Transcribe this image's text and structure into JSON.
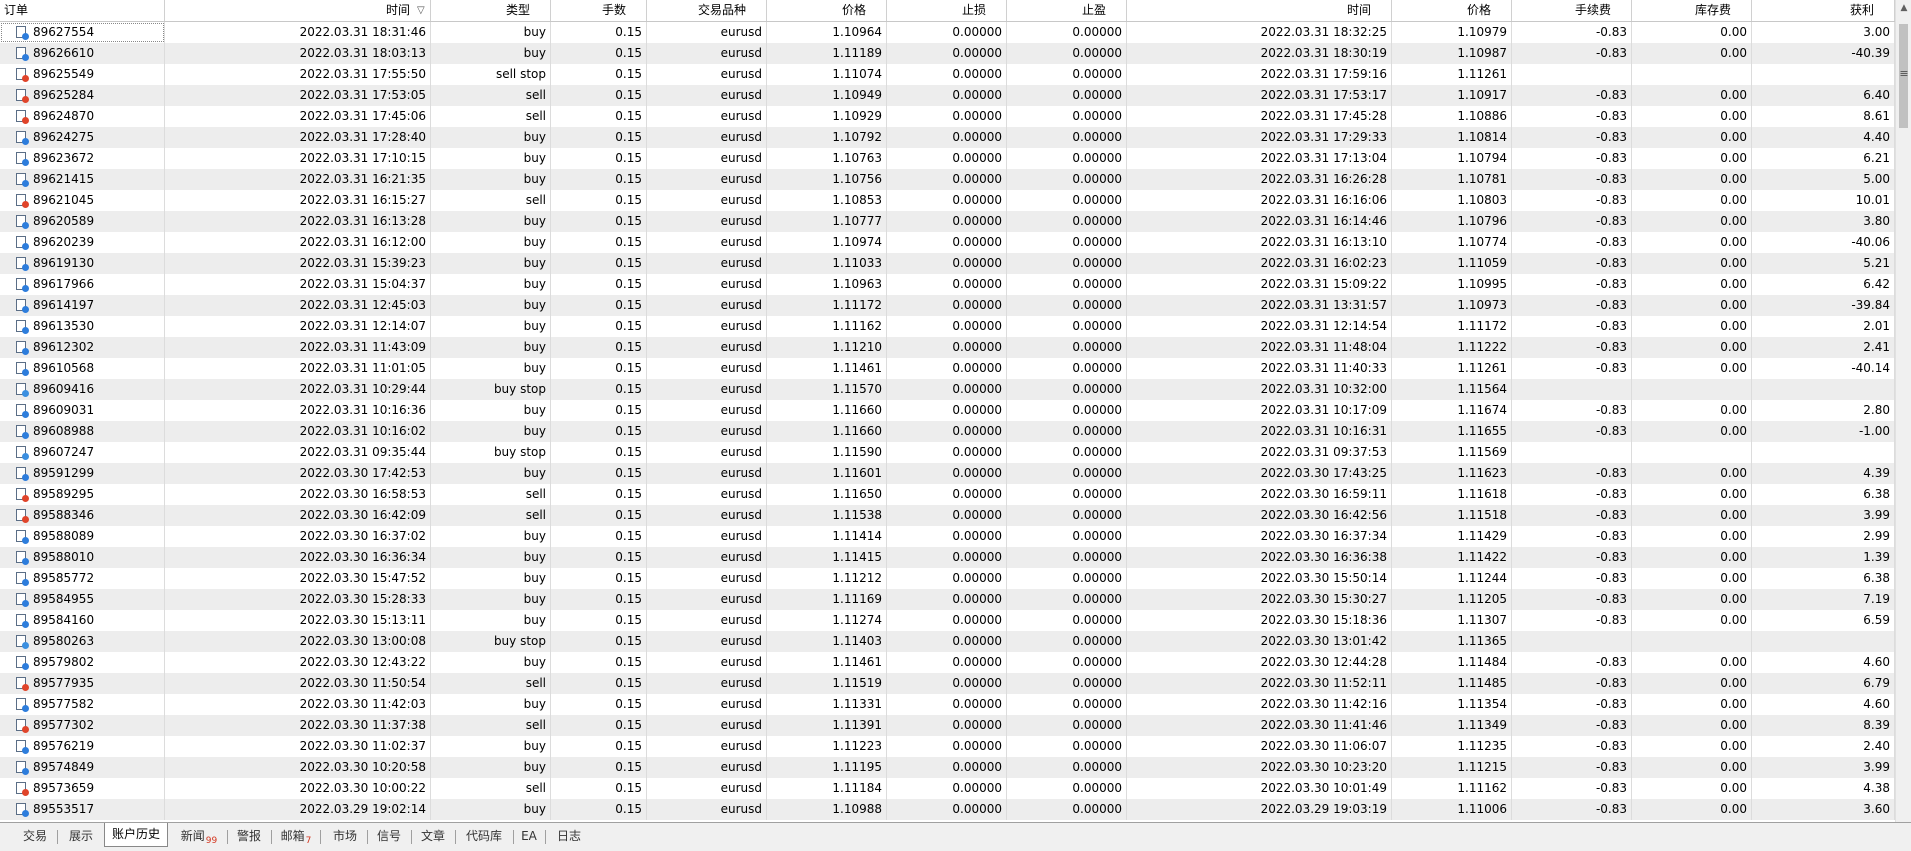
{
  "columns": [
    "订单",
    "时间",
    "类型",
    "手数",
    "交易品种",
    "价格",
    "止损",
    "止盈",
    "时间",
    "价格",
    "手续费",
    "库存费",
    "获利"
  ],
  "sort_indicator": "▽",
  "rows": [
    {
      "order": "89627554",
      "open_time": "2022.03.31 18:31:46",
      "type": "buy",
      "lots": "0.15",
      "symbol": "eurusd",
      "open_price": "1.10964",
      "sl": "0.00000",
      "tp": "0.00000",
      "close_time": "2022.03.31 18:32:25",
      "close_price": "1.10979",
      "commission": "-0.83",
      "swap": "0.00",
      "profit": "3.00",
      "icon": "buy"
    },
    {
      "order": "89626610",
      "open_time": "2022.03.31 18:03:13",
      "type": "buy",
      "lots": "0.15",
      "symbol": "eurusd",
      "open_price": "1.11189",
      "sl": "0.00000",
      "tp": "0.00000",
      "close_time": "2022.03.31 18:30:19",
      "close_price": "1.10987",
      "commission": "-0.83",
      "swap": "0.00",
      "profit": "-40.39",
      "icon": "buy"
    },
    {
      "order": "89625549",
      "open_time": "2022.03.31 17:55:50",
      "type": "sell stop",
      "lots": "0.15",
      "symbol": "eurusd",
      "open_price": "1.11074",
      "sl": "0.00000",
      "tp": "0.00000",
      "close_time": "2022.03.31 17:59:16",
      "close_price": "1.11261",
      "commission": "",
      "swap": "",
      "profit": "",
      "icon": "sell"
    },
    {
      "order": "89625284",
      "open_time": "2022.03.31 17:53:05",
      "type": "sell",
      "lots": "0.15",
      "symbol": "eurusd",
      "open_price": "1.10949",
      "sl": "0.00000",
      "tp": "0.00000",
      "close_time": "2022.03.31 17:53:17",
      "close_price": "1.10917",
      "commission": "-0.83",
      "swap": "0.00",
      "profit": "6.40",
      "icon": "sell"
    },
    {
      "order": "89624870",
      "open_time": "2022.03.31 17:45:06",
      "type": "sell",
      "lots": "0.15",
      "symbol": "eurusd",
      "open_price": "1.10929",
      "sl": "0.00000",
      "tp": "0.00000",
      "close_time": "2022.03.31 17:45:28",
      "close_price": "1.10886",
      "commission": "-0.83",
      "swap": "0.00",
      "profit": "8.61",
      "icon": "sell"
    },
    {
      "order": "89624275",
      "open_time": "2022.03.31 17:28:40",
      "type": "buy",
      "lots": "0.15",
      "symbol": "eurusd",
      "open_price": "1.10792",
      "sl": "0.00000",
      "tp": "0.00000",
      "close_time": "2022.03.31 17:29:33",
      "close_price": "1.10814",
      "commission": "-0.83",
      "swap": "0.00",
      "profit": "4.40",
      "icon": "buy"
    },
    {
      "order": "89623672",
      "open_time": "2022.03.31 17:10:15",
      "type": "buy",
      "lots": "0.15",
      "symbol": "eurusd",
      "open_price": "1.10763",
      "sl": "0.00000",
      "tp": "0.00000",
      "close_time": "2022.03.31 17:13:04",
      "close_price": "1.10794",
      "commission": "-0.83",
      "swap": "0.00",
      "profit": "6.21",
      "icon": "buy"
    },
    {
      "order": "89621415",
      "open_time": "2022.03.31 16:21:35",
      "type": "buy",
      "lots": "0.15",
      "symbol": "eurusd",
      "open_price": "1.10756",
      "sl": "0.00000",
      "tp": "0.00000",
      "close_time": "2022.03.31 16:26:28",
      "close_price": "1.10781",
      "commission": "-0.83",
      "swap": "0.00",
      "profit": "5.00",
      "icon": "buy"
    },
    {
      "order": "89621045",
      "open_time": "2022.03.31 16:15:27",
      "type": "sell",
      "lots": "0.15",
      "symbol": "eurusd",
      "open_price": "1.10853",
      "sl": "0.00000",
      "tp": "0.00000",
      "close_time": "2022.03.31 16:16:06",
      "close_price": "1.10803",
      "commission": "-0.83",
      "swap": "0.00",
      "profit": "10.01",
      "icon": "sell"
    },
    {
      "order": "89620589",
      "open_time": "2022.03.31 16:13:28",
      "type": "buy",
      "lots": "0.15",
      "symbol": "eurusd",
      "open_price": "1.10777",
      "sl": "0.00000",
      "tp": "0.00000",
      "close_time": "2022.03.31 16:14:46",
      "close_price": "1.10796",
      "commission": "-0.83",
      "swap": "0.00",
      "profit": "3.80",
      "icon": "buy"
    },
    {
      "order": "89620239",
      "open_time": "2022.03.31 16:12:00",
      "type": "buy",
      "lots": "0.15",
      "symbol": "eurusd",
      "open_price": "1.10974",
      "sl": "0.00000",
      "tp": "0.00000",
      "close_time": "2022.03.31 16:13:10",
      "close_price": "1.10774",
      "commission": "-0.83",
      "swap": "0.00",
      "profit": "-40.06",
      "icon": "buy"
    },
    {
      "order": "89619130",
      "open_time": "2022.03.31 15:39:23",
      "type": "buy",
      "lots": "0.15",
      "symbol": "eurusd",
      "open_price": "1.11033",
      "sl": "0.00000",
      "tp": "0.00000",
      "close_time": "2022.03.31 16:02:23",
      "close_price": "1.11059",
      "commission": "-0.83",
      "swap": "0.00",
      "profit": "5.21",
      "icon": "buy"
    },
    {
      "order": "89617966",
      "open_time": "2022.03.31 15:04:37",
      "type": "buy",
      "lots": "0.15",
      "symbol": "eurusd",
      "open_price": "1.10963",
      "sl": "0.00000",
      "tp": "0.00000",
      "close_time": "2022.03.31 15:09:22",
      "close_price": "1.10995",
      "commission": "-0.83",
      "swap": "0.00",
      "profit": "6.42",
      "icon": "buy"
    },
    {
      "order": "89614197",
      "open_time": "2022.03.31 12:45:03",
      "type": "buy",
      "lots": "0.15",
      "symbol": "eurusd",
      "open_price": "1.11172",
      "sl": "0.00000",
      "tp": "0.00000",
      "close_time": "2022.03.31 13:31:57",
      "close_price": "1.10973",
      "commission": "-0.83",
      "swap": "0.00",
      "profit": "-39.84",
      "icon": "buy"
    },
    {
      "order": "89613530",
      "open_time": "2022.03.31 12:14:07",
      "type": "buy",
      "lots": "0.15",
      "symbol": "eurusd",
      "open_price": "1.11162",
      "sl": "0.00000",
      "tp": "0.00000",
      "close_time": "2022.03.31 12:14:54",
      "close_price": "1.11172",
      "commission": "-0.83",
      "swap": "0.00",
      "profit": "2.01",
      "icon": "buy"
    },
    {
      "order": "89612302",
      "open_time": "2022.03.31 11:43:09",
      "type": "buy",
      "lots": "0.15",
      "symbol": "eurusd",
      "open_price": "1.11210",
      "sl": "0.00000",
      "tp": "0.00000",
      "close_time": "2022.03.31 11:48:04",
      "close_price": "1.11222",
      "commission": "-0.83",
      "swap": "0.00",
      "profit": "2.41",
      "icon": "buy"
    },
    {
      "order": "89610568",
      "open_time": "2022.03.31 11:01:05",
      "type": "buy",
      "lots": "0.15",
      "symbol": "eurusd",
      "open_price": "1.11461",
      "sl": "0.00000",
      "tp": "0.00000",
      "close_time": "2022.03.31 11:40:33",
      "close_price": "1.11261",
      "commission": "-0.83",
      "swap": "0.00",
      "profit": "-40.14",
      "icon": "buy"
    },
    {
      "order": "89609416",
      "open_time": "2022.03.31 10:29:44",
      "type": "buy stop",
      "lots": "0.15",
      "symbol": "eurusd",
      "open_price": "1.11570",
      "sl": "0.00000",
      "tp": "0.00000",
      "close_time": "2022.03.31 10:32:00",
      "close_price": "1.11564",
      "commission": "",
      "swap": "",
      "profit": "",
      "icon": "pend"
    },
    {
      "order": "89609031",
      "open_time": "2022.03.31 10:16:36",
      "type": "buy",
      "lots": "0.15",
      "symbol": "eurusd",
      "open_price": "1.11660",
      "sl": "0.00000",
      "tp": "0.00000",
      "close_time": "2022.03.31 10:17:09",
      "close_price": "1.11674",
      "commission": "-0.83",
      "swap": "0.00",
      "profit": "2.80",
      "icon": "buy"
    },
    {
      "order": "89608988",
      "open_time": "2022.03.31 10:16:02",
      "type": "buy",
      "lots": "0.15",
      "symbol": "eurusd",
      "open_price": "1.11660",
      "sl": "0.00000",
      "tp": "0.00000",
      "close_time": "2022.03.31 10:16:31",
      "close_price": "1.11655",
      "commission": "-0.83",
      "swap": "0.00",
      "profit": "-1.00",
      "icon": "buy"
    },
    {
      "order": "89607247",
      "open_time": "2022.03.31 09:35:44",
      "type": "buy stop",
      "lots": "0.15",
      "symbol": "eurusd",
      "open_price": "1.11590",
      "sl": "0.00000",
      "tp": "0.00000",
      "close_time": "2022.03.31 09:37:53",
      "close_price": "1.11569",
      "commission": "",
      "swap": "",
      "profit": "",
      "icon": "pend"
    },
    {
      "order": "89591299",
      "open_time": "2022.03.30 17:42:53",
      "type": "buy",
      "lots": "0.15",
      "symbol": "eurusd",
      "open_price": "1.11601",
      "sl": "0.00000",
      "tp": "0.00000",
      "close_time": "2022.03.30 17:43:25",
      "close_price": "1.11623",
      "commission": "-0.83",
      "swap": "0.00",
      "profit": "4.39",
      "icon": "buy"
    },
    {
      "order": "89589295",
      "open_time": "2022.03.30 16:58:53",
      "type": "sell",
      "lots": "0.15",
      "symbol": "eurusd",
      "open_price": "1.11650",
      "sl": "0.00000",
      "tp": "0.00000",
      "close_time": "2022.03.30 16:59:11",
      "close_price": "1.11618",
      "commission": "-0.83",
      "swap": "0.00",
      "profit": "6.38",
      "icon": "sell"
    },
    {
      "order": "89588346",
      "open_time": "2022.03.30 16:42:09",
      "type": "sell",
      "lots": "0.15",
      "symbol": "eurusd",
      "open_price": "1.11538",
      "sl": "0.00000",
      "tp": "0.00000",
      "close_time": "2022.03.30 16:42:56",
      "close_price": "1.11518",
      "commission": "-0.83",
      "swap": "0.00",
      "profit": "3.99",
      "icon": "sell"
    },
    {
      "order": "89588089",
      "open_time": "2022.03.30 16:37:02",
      "type": "buy",
      "lots": "0.15",
      "symbol": "eurusd",
      "open_price": "1.11414",
      "sl": "0.00000",
      "tp": "0.00000",
      "close_time": "2022.03.30 16:37:34",
      "close_price": "1.11429",
      "commission": "-0.83",
      "swap": "0.00",
      "profit": "2.99",
      "icon": "buy"
    },
    {
      "order": "89588010",
      "open_time": "2022.03.30 16:36:34",
      "type": "buy",
      "lots": "0.15",
      "symbol": "eurusd",
      "open_price": "1.11415",
      "sl": "0.00000",
      "tp": "0.00000",
      "close_time": "2022.03.30 16:36:38",
      "close_price": "1.11422",
      "commission": "-0.83",
      "swap": "0.00",
      "profit": "1.39",
      "icon": "buy"
    },
    {
      "order": "89585772",
      "open_time": "2022.03.30 15:47:52",
      "type": "buy",
      "lots": "0.15",
      "symbol": "eurusd",
      "open_price": "1.11212",
      "sl": "0.00000",
      "tp": "0.00000",
      "close_time": "2022.03.30 15:50:14",
      "close_price": "1.11244",
      "commission": "-0.83",
      "swap": "0.00",
      "profit": "6.38",
      "icon": "buy"
    },
    {
      "order": "89584955",
      "open_time": "2022.03.30 15:28:33",
      "type": "buy",
      "lots": "0.15",
      "symbol": "eurusd",
      "open_price": "1.11169",
      "sl": "0.00000",
      "tp": "0.00000",
      "close_time": "2022.03.30 15:30:27",
      "close_price": "1.11205",
      "commission": "-0.83",
      "swap": "0.00",
      "profit": "7.19",
      "icon": "buy"
    },
    {
      "order": "89584160",
      "open_time": "2022.03.30 15:13:11",
      "type": "buy",
      "lots": "0.15",
      "symbol": "eurusd",
      "open_price": "1.11274",
      "sl": "0.00000",
      "tp": "0.00000",
      "close_time": "2022.03.30 15:18:36",
      "close_price": "1.11307",
      "commission": "-0.83",
      "swap": "0.00",
      "profit": "6.59",
      "icon": "buy"
    },
    {
      "order": "89580263",
      "open_time": "2022.03.30 13:00:08",
      "type": "buy stop",
      "lots": "0.15",
      "symbol": "eurusd",
      "open_price": "1.11403",
      "sl": "0.00000",
      "tp": "0.00000",
      "close_time": "2022.03.30 13:01:42",
      "close_price": "1.11365",
      "commission": "",
      "swap": "",
      "profit": "",
      "icon": "pend"
    },
    {
      "order": "89579802",
      "open_time": "2022.03.30 12:43:22",
      "type": "buy",
      "lots": "0.15",
      "symbol": "eurusd",
      "open_price": "1.11461",
      "sl": "0.00000",
      "tp": "0.00000",
      "close_time": "2022.03.30 12:44:28",
      "close_price": "1.11484",
      "commission": "-0.83",
      "swap": "0.00",
      "profit": "4.60",
      "icon": "buy"
    },
    {
      "order": "89577935",
      "open_time": "2022.03.30 11:50:54",
      "type": "sell",
      "lots": "0.15",
      "symbol": "eurusd",
      "open_price": "1.11519",
      "sl": "0.00000",
      "tp": "0.00000",
      "close_time": "2022.03.30 11:52:11",
      "close_price": "1.11485",
      "commission": "-0.83",
      "swap": "0.00",
      "profit": "6.79",
      "icon": "sell"
    },
    {
      "order": "89577582",
      "open_time": "2022.03.30 11:42:03",
      "type": "buy",
      "lots": "0.15",
      "symbol": "eurusd",
      "open_price": "1.11331",
      "sl": "0.00000",
      "tp": "0.00000",
      "close_time": "2022.03.30 11:42:16",
      "close_price": "1.11354",
      "commission": "-0.83",
      "swap": "0.00",
      "profit": "4.60",
      "icon": "buy"
    },
    {
      "order": "89577302",
      "open_time": "2022.03.30 11:37:38",
      "type": "sell",
      "lots": "0.15",
      "symbol": "eurusd",
      "open_price": "1.11391",
      "sl": "0.00000",
      "tp": "0.00000",
      "close_time": "2022.03.30 11:41:46",
      "close_price": "1.11349",
      "commission": "-0.83",
      "swap": "0.00",
      "profit": "8.39",
      "icon": "sell"
    },
    {
      "order": "89576219",
      "open_time": "2022.03.30 11:02:37",
      "type": "buy",
      "lots": "0.15",
      "symbol": "eurusd",
      "open_price": "1.11223",
      "sl": "0.00000",
      "tp": "0.00000",
      "close_time": "2022.03.30 11:06:07",
      "close_price": "1.11235",
      "commission": "-0.83",
      "swap": "0.00",
      "profit": "2.40",
      "icon": "buy"
    },
    {
      "order": "89574849",
      "open_time": "2022.03.30 10:20:58",
      "type": "buy",
      "lots": "0.15",
      "symbol": "eurusd",
      "open_price": "1.11195",
      "sl": "0.00000",
      "tp": "0.00000",
      "close_time": "2022.03.30 10:23:20",
      "close_price": "1.11215",
      "commission": "-0.83",
      "swap": "0.00",
      "profit": "3.99",
      "icon": "buy"
    },
    {
      "order": "89573659",
      "open_time": "2022.03.30 10:00:22",
      "type": "sell",
      "lots": "0.15",
      "symbol": "eurusd",
      "open_price": "1.11184",
      "sl": "0.00000",
      "tp": "0.00000",
      "close_time": "2022.03.30 10:01:49",
      "close_price": "1.11162",
      "commission": "-0.83",
      "swap": "0.00",
      "profit": "4.38",
      "icon": "sell"
    },
    {
      "order": "89553517",
      "open_time": "2022.03.29 19:02:14",
      "type": "buy",
      "lots": "0.15",
      "symbol": "eurusd",
      "open_price": "1.10988",
      "sl": "0.00000",
      "tp": "0.00000",
      "close_time": "2022.03.29 19:03:19",
      "close_price": "1.11006",
      "commission": "-0.83",
      "swap": "0.00",
      "profit": "3.60",
      "icon": "buy"
    }
  ],
  "tabs": [
    {
      "label": "交易",
      "badge": ""
    },
    {
      "label": "展示",
      "badge": ""
    },
    {
      "label": "账户历史",
      "badge": "",
      "active": true
    },
    {
      "label": "新闻",
      "badge": "99"
    },
    {
      "label": "警报",
      "badge": ""
    },
    {
      "label": "邮箱",
      "badge": "7"
    },
    {
      "label": "市场",
      "badge": ""
    },
    {
      "label": "信号",
      "badge": ""
    },
    {
      "label": "文章",
      "badge": ""
    },
    {
      "label": "代码库",
      "badge": ""
    },
    {
      "label": "EA",
      "badge": ""
    },
    {
      "label": "日志",
      "badge": ""
    }
  ],
  "scrollbar": {
    "up_glyph": "▲",
    "menu_glyph": "≡"
  },
  "colors": {
    "alt_row": "#ededed",
    "buy_icon": "#2d7ddc",
    "sell_icon": "#e0442a",
    "badge": "#d4361f"
  }
}
